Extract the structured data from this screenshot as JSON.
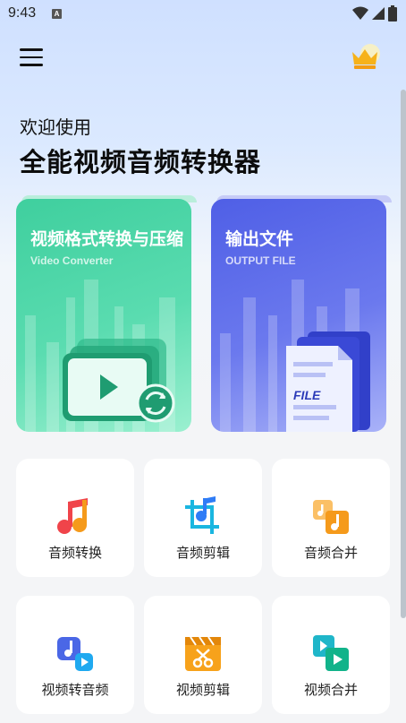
{
  "status_bar": {
    "time": "9:43",
    "badge": "A"
  },
  "header": {
    "welcome": "欢迎使用",
    "title": "全能视频音频转换器"
  },
  "cards": [
    {
      "title": "视频格式转换与压缩",
      "subtitle": "Video Converter"
    },
    {
      "title": "输出文件",
      "subtitle": "OUTPUT FILE",
      "file_label": "FILE"
    }
  ],
  "tools": [
    {
      "label": "音频转换",
      "icon": "music-note-icon"
    },
    {
      "label": "音频剪辑",
      "icon": "audio-crop-icon"
    },
    {
      "label": "音频合并",
      "icon": "audio-merge-icon"
    },
    {
      "label": "视频转音频",
      "icon": "video-to-audio-icon"
    },
    {
      "label": "视频剪辑",
      "icon": "video-clip-icon"
    },
    {
      "label": "视频合并",
      "icon": "video-merge-icon"
    }
  ],
  "colors": {
    "green": "#3fcf9e",
    "blue": "#4f5fe6",
    "orange": "#f59a1b",
    "red": "#f0444a",
    "accent_blue": "#2f7cf6",
    "crown": "#f6b21a"
  }
}
